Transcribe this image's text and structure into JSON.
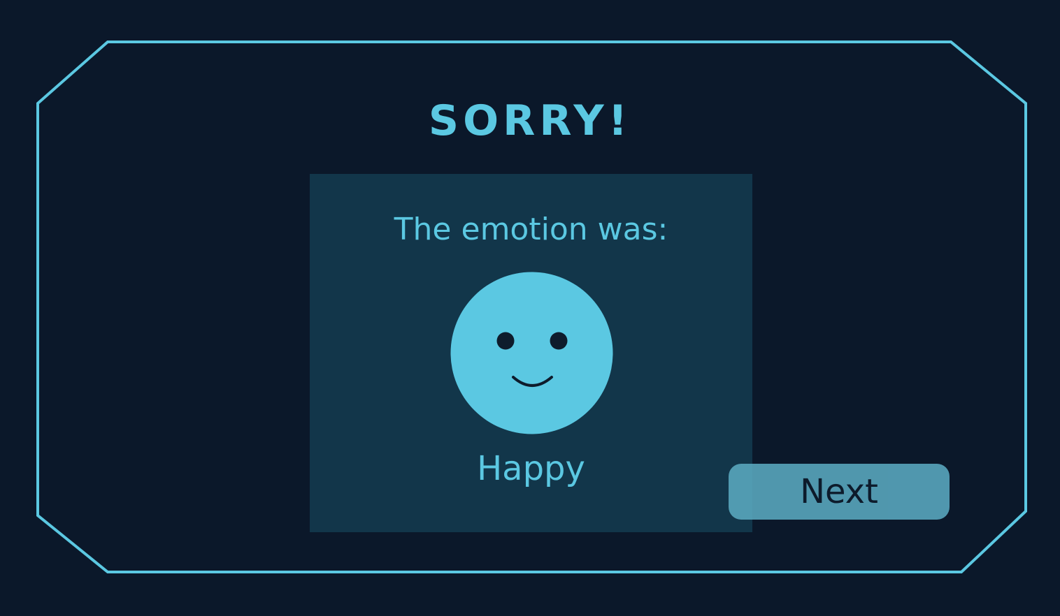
{
  "screen": {
    "title": "SORRY!",
    "prompt": "The emotion was:",
    "emotion": "Happy",
    "emotion_icon": "smiley-face-icon"
  },
  "controls": {
    "next_label": "Next"
  },
  "colors": {
    "background": "#0b182a",
    "accent": "#5bc8e2",
    "panel": "#12364a",
    "button": "#5aa9c0",
    "button_text": "#0e1c2c"
  }
}
